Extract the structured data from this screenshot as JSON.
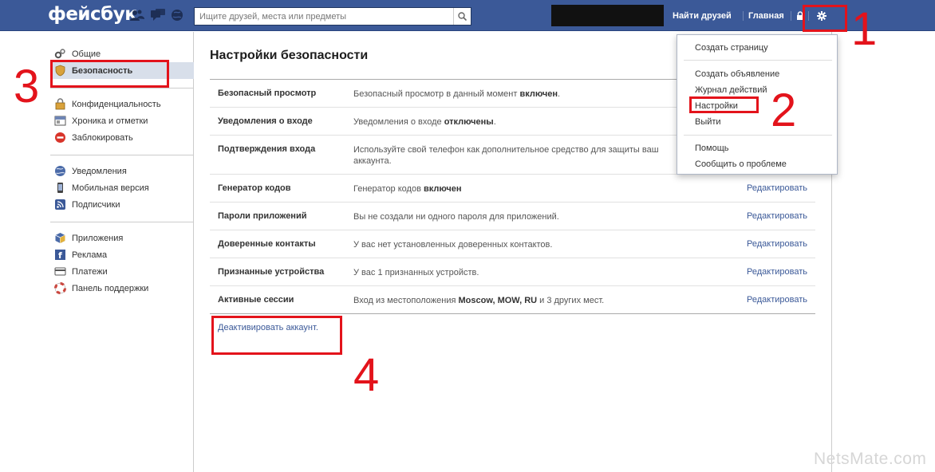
{
  "header": {
    "logo": "фейсбук",
    "search_placeholder": "Ищите друзей, места или предметы",
    "find_friends": "Найти друзей",
    "home": "Главная"
  },
  "sidebar": {
    "groups": [
      [
        {
          "label": "Общие",
          "icon": "gears-icon"
        },
        {
          "label": "Безопасность",
          "icon": "shield-icon",
          "active": true
        }
      ],
      [
        {
          "label": "Конфиденциальность",
          "icon": "privacy-lock-icon"
        },
        {
          "label": "Хроника и отметки",
          "icon": "timeline-icon"
        },
        {
          "label": "Заблокировать",
          "icon": "block-icon"
        }
      ],
      [
        {
          "label": "Уведомления",
          "icon": "globe-icon"
        },
        {
          "label": "Мобильная версия",
          "icon": "mobile-icon"
        },
        {
          "label": "Подписчики",
          "icon": "rss-icon"
        }
      ],
      [
        {
          "label": "Приложения",
          "icon": "apps-cube-icon"
        },
        {
          "label": "Реклама",
          "icon": "ads-icon"
        },
        {
          "label": "Платежи",
          "icon": "payments-card-icon"
        },
        {
          "label": "Панель поддержки",
          "icon": "lifebuoy-icon"
        }
      ]
    ]
  },
  "main": {
    "title": "Настройки безопасности",
    "rows": [
      {
        "label": "Безопасный просмотр",
        "desc": "Безопасный просмотр в данный момент ",
        "desc_bold": "включен",
        "desc_after": ".",
        "edit": ""
      },
      {
        "label": "Уведомления о входе",
        "desc": "Уведомления о входе ",
        "desc_bold": "отключены",
        "desc_after": ".",
        "edit": ""
      },
      {
        "label": "Подтверждения входа",
        "desc": "Используйте свой телефон как дополнительное средство для защиты ваш",
        "desc_bold": "",
        "desc_after": "",
        "desc_line2": "аккаунта.",
        "edit": "",
        "tall": true
      },
      {
        "label": "Генератор кодов",
        "desc": "Генератор кодов ",
        "desc_bold": "включен",
        "desc_after": "",
        "edit": "Редактировать"
      },
      {
        "label": "Пароли приложений",
        "desc": "Вы не создали ни одного пароля для приложений.",
        "desc_bold": "",
        "desc_after": "",
        "edit": "Редактировать"
      },
      {
        "label": "Доверенные контакты",
        "desc": "У вас нет установленных доверенных контактов.",
        "desc_bold": "",
        "desc_after": "",
        "edit": "Редактировать"
      },
      {
        "label": "Признанные устройства",
        "desc": "У вас 1 признанных устройств.",
        "desc_bold": "",
        "desc_after": "",
        "edit": "Редактировать"
      },
      {
        "label": "Активные сессии",
        "desc": "Вход из местоположения ",
        "desc_bold": "Moscow, MOW, RU",
        "desc_after": " и 3 других мест.",
        "edit": "Редактировать"
      }
    ],
    "deactivate": "Деактивировать аккаунт."
  },
  "dropdown": {
    "items": [
      "Создать страницу",
      "Создать объявление",
      "Журнал действий",
      "Настройки",
      "Выйти",
      "Помощь",
      "Сообщить о проблеме"
    ]
  },
  "annotations": {
    "n1": "1",
    "n2": "2",
    "n3": "3",
    "n4": "4",
    "color": "#e3131b"
  },
  "watermark": "NetsMate.com",
  "colors": {
    "brand": "#3b5998",
    "link": "#3b5998",
    "active_item": "#d8dfea"
  }
}
